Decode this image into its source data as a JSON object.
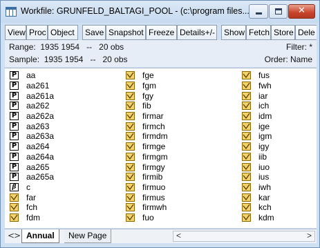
{
  "window": {
    "title": "Workfile: GRUNFELD_BALTAGI_POOL - (c:\\program files...",
    "controls": {
      "minimize": "minimize",
      "maximize": "maximize",
      "close": "✕"
    }
  },
  "toolbar": [
    "View",
    "Proc",
    "Object",
    "Save",
    "Snapshot",
    "Freeze",
    "Details+/-",
    "Show",
    "Fetch",
    "Store",
    "Dele"
  ],
  "info": {
    "range_label": "Range:",
    "range_value": "1935 1954",
    "range_sep": "--",
    "range_obs": "20 obs",
    "sample_label": "Sample:",
    "sample_value": "1935 1954",
    "sample_sep": "--",
    "sample_obs": "20 obs",
    "filter": "Filter: *",
    "order": "Order: Name"
  },
  "objects": {
    "col1": [
      {
        "name": "aa",
        "icon": "pool-icon"
      },
      {
        "name": "aa261",
        "icon": "pool-icon"
      },
      {
        "name": "aa261a",
        "icon": "pool-icon"
      },
      {
        "name": "aa262",
        "icon": "pool-icon"
      },
      {
        "name": "aa262a",
        "icon": "pool-icon"
      },
      {
        "name": "aa263",
        "icon": "pool-icon"
      },
      {
        "name": "aa263a",
        "icon": "pool-icon"
      },
      {
        "name": "aa264",
        "icon": "pool-icon"
      },
      {
        "name": "aa264a",
        "icon": "pool-icon"
      },
      {
        "name": "aa265",
        "icon": "pool-icon"
      },
      {
        "name": "aa265a",
        "icon": "pool-icon"
      },
      {
        "name": "c",
        "icon": "coefficient-icon"
      },
      {
        "name": "far",
        "icon": "series-icon"
      },
      {
        "name": "fch",
        "icon": "series-icon"
      },
      {
        "name": "fdm",
        "icon": "series-icon"
      }
    ],
    "col2": [
      {
        "name": "fge",
        "icon": "series-icon"
      },
      {
        "name": "fgm",
        "icon": "series-icon"
      },
      {
        "name": "fgy",
        "icon": "series-icon"
      },
      {
        "name": "fib",
        "icon": "series-icon"
      },
      {
        "name": "firmar",
        "icon": "series-icon"
      },
      {
        "name": "firmch",
        "icon": "series-icon"
      },
      {
        "name": "firmdm",
        "icon": "series-icon"
      },
      {
        "name": "firmge",
        "icon": "series-icon"
      },
      {
        "name": "firmgm",
        "icon": "series-icon"
      },
      {
        "name": "firmgy",
        "icon": "series-icon"
      },
      {
        "name": "firmib",
        "icon": "series-icon"
      },
      {
        "name": "firmuo",
        "icon": "series-icon"
      },
      {
        "name": "firmus",
        "icon": "series-icon"
      },
      {
        "name": "firmwh",
        "icon": "series-icon"
      },
      {
        "name": "fuo",
        "icon": "series-icon"
      }
    ],
    "col3": [
      {
        "name": "fus",
        "icon": "series-icon"
      },
      {
        "name": "fwh",
        "icon": "series-icon"
      },
      {
        "name": "iar",
        "icon": "series-icon"
      },
      {
        "name": "ich",
        "icon": "series-icon"
      },
      {
        "name": "idm",
        "icon": "series-icon"
      },
      {
        "name": "ige",
        "icon": "series-icon"
      },
      {
        "name": "igm",
        "icon": "series-icon"
      },
      {
        "name": "igy",
        "icon": "series-icon"
      },
      {
        "name": "iib",
        "icon": "series-icon"
      },
      {
        "name": "iuo",
        "icon": "series-icon"
      },
      {
        "name": "ius",
        "icon": "series-icon"
      },
      {
        "name": "iwh",
        "icon": "series-icon"
      },
      {
        "name": "kar",
        "icon": "series-icon"
      },
      {
        "name": "kch",
        "icon": "series-icon"
      },
      {
        "name": "kdm",
        "icon": "series-icon"
      }
    ]
  },
  "icon_glyphs": {
    "pool": "P",
    "coefficient": "β"
  },
  "tabs": {
    "left_arrow": "<",
    "right_arrow": ">",
    "active": "Annual",
    "other": "New Page"
  },
  "scrollbar": {
    "left": "<",
    "right": ">"
  }
}
